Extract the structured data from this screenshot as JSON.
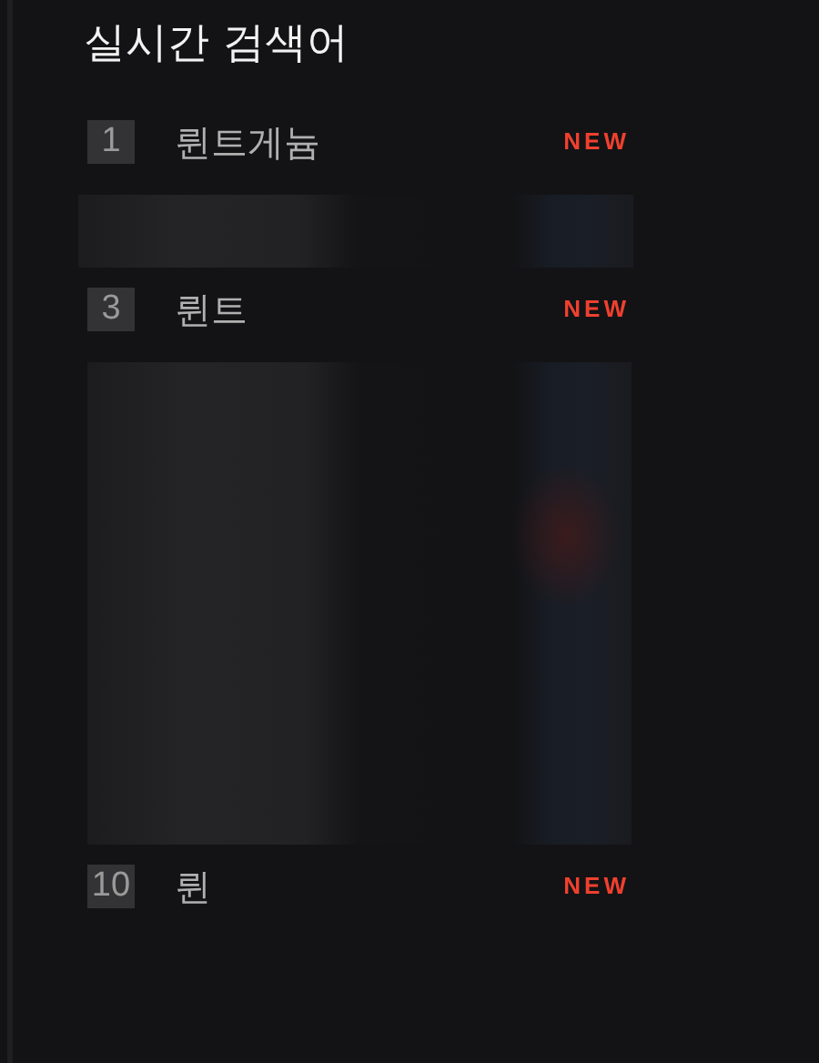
{
  "title": "실시간 검색어",
  "items": [
    {
      "kind": "ranked",
      "rank": "1",
      "keyword": "륀트게늄",
      "badge": "NEW"
    },
    {
      "kind": "redacted"
    },
    {
      "kind": "ranked",
      "rank": "3",
      "keyword": "륀트",
      "badge": "NEW"
    },
    {
      "kind": "redacted"
    },
    {
      "kind": "redacted"
    },
    {
      "kind": "redacted"
    },
    {
      "kind": "redacted"
    },
    {
      "kind": "redacted"
    },
    {
      "kind": "redacted"
    },
    {
      "kind": "ranked",
      "rank": "10",
      "keyword": "륀",
      "badge": "NEW"
    }
  ]
}
